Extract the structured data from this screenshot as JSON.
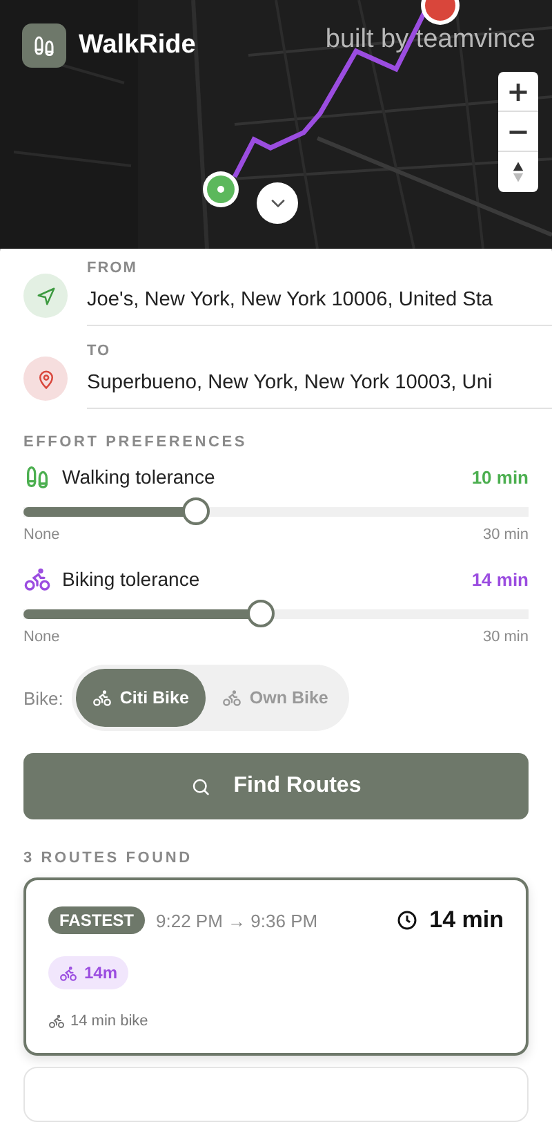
{
  "app": {
    "name": "WalkRide",
    "credit": "built by teamvince"
  },
  "map_controls": [
    "+",
    "−"
  ],
  "locations": [
    {
      "kind": "from",
      "label": "FROM",
      "value": "Joe's, New York, New York 10006, United Sta"
    },
    {
      "kind": "to",
      "label": "TO",
      "value": "Superbueno, New York, New York 10003, Uni"
    }
  ],
  "effort": {
    "title": "EFFORT PREFERENCES",
    "sliders": [
      {
        "kind": "walk",
        "label": "Walking tolerance",
        "reading": "10 min",
        "level": 0.34,
        "min": "None",
        "max": "30 min",
        "color": "#4caf50"
      },
      {
        "kind": "bike",
        "label": "Biking tolerance",
        "reading": "14 min",
        "level": 0.466,
        "min": "None",
        "max": "30 min",
        "color": "#9b4de0"
      }
    ]
  },
  "bike": {
    "label": "Bike:",
    "options": [
      {
        "label": "Citi Bike",
        "selected": true
      },
      {
        "label": "Own Bike",
        "selected": false
      }
    ]
  },
  "find_button": "Find Routes",
  "results_title": "3 ROUTES FOUND",
  "routes": [
    {
      "selected": true,
      "badge": "FASTEST",
      "times": "9:22 PM → 9:36 PM",
      "duration": "14 min",
      "legs": [
        {
          "kind": "bike",
          "label": "14m"
        }
      ],
      "summary": "14 min bike"
    },
    {
      "selected": false
    }
  ]
}
